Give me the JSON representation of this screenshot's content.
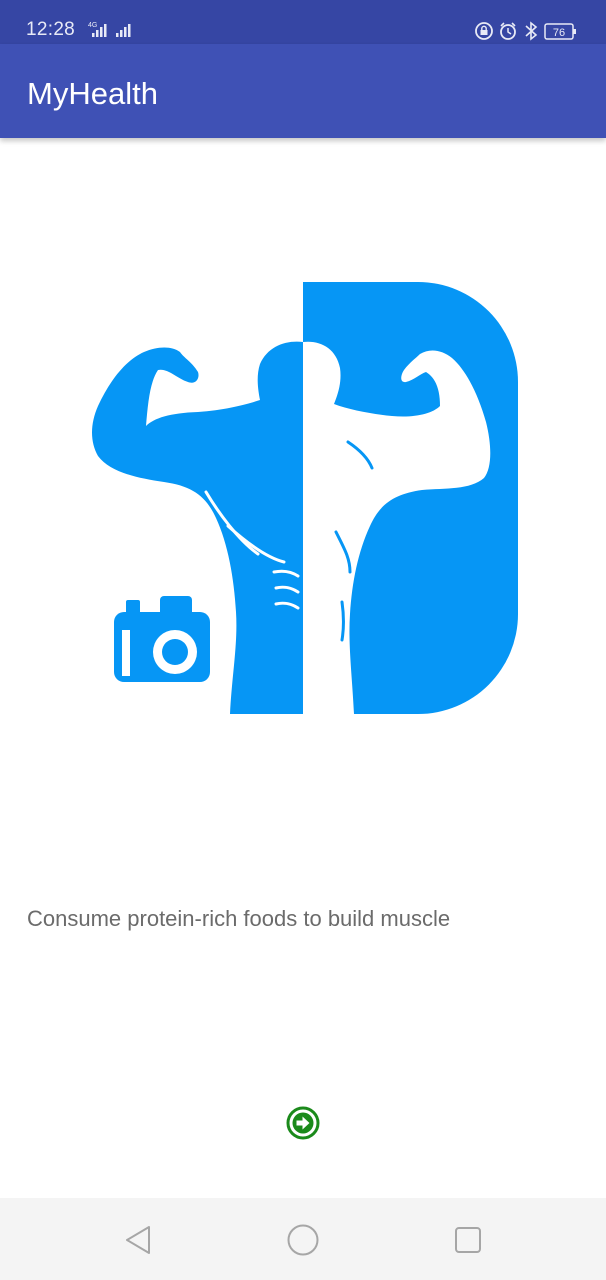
{
  "status_bar": {
    "time": "12:28",
    "network_label": "4G",
    "battery_level": "76",
    "icons": [
      "signal-4g-icon",
      "signal-icon",
      "lock-rotation-icon",
      "alarm-icon",
      "bluetooth-icon",
      "battery-icon"
    ]
  },
  "app_bar": {
    "title": "MyHealth",
    "color": "#3f51b5",
    "status_color": "#3646a4"
  },
  "hero": {
    "icon": "muscle-camera-logo",
    "accent_color": "#0696f5"
  },
  "tip": {
    "text": "Consume protein-rich foods to build muscle"
  },
  "next_button": {
    "icon": "arrow-right-circle-icon",
    "color": "#1b8a1b"
  },
  "nav_bar": {
    "icons": [
      "back-icon",
      "home-icon",
      "recents-icon"
    ]
  }
}
